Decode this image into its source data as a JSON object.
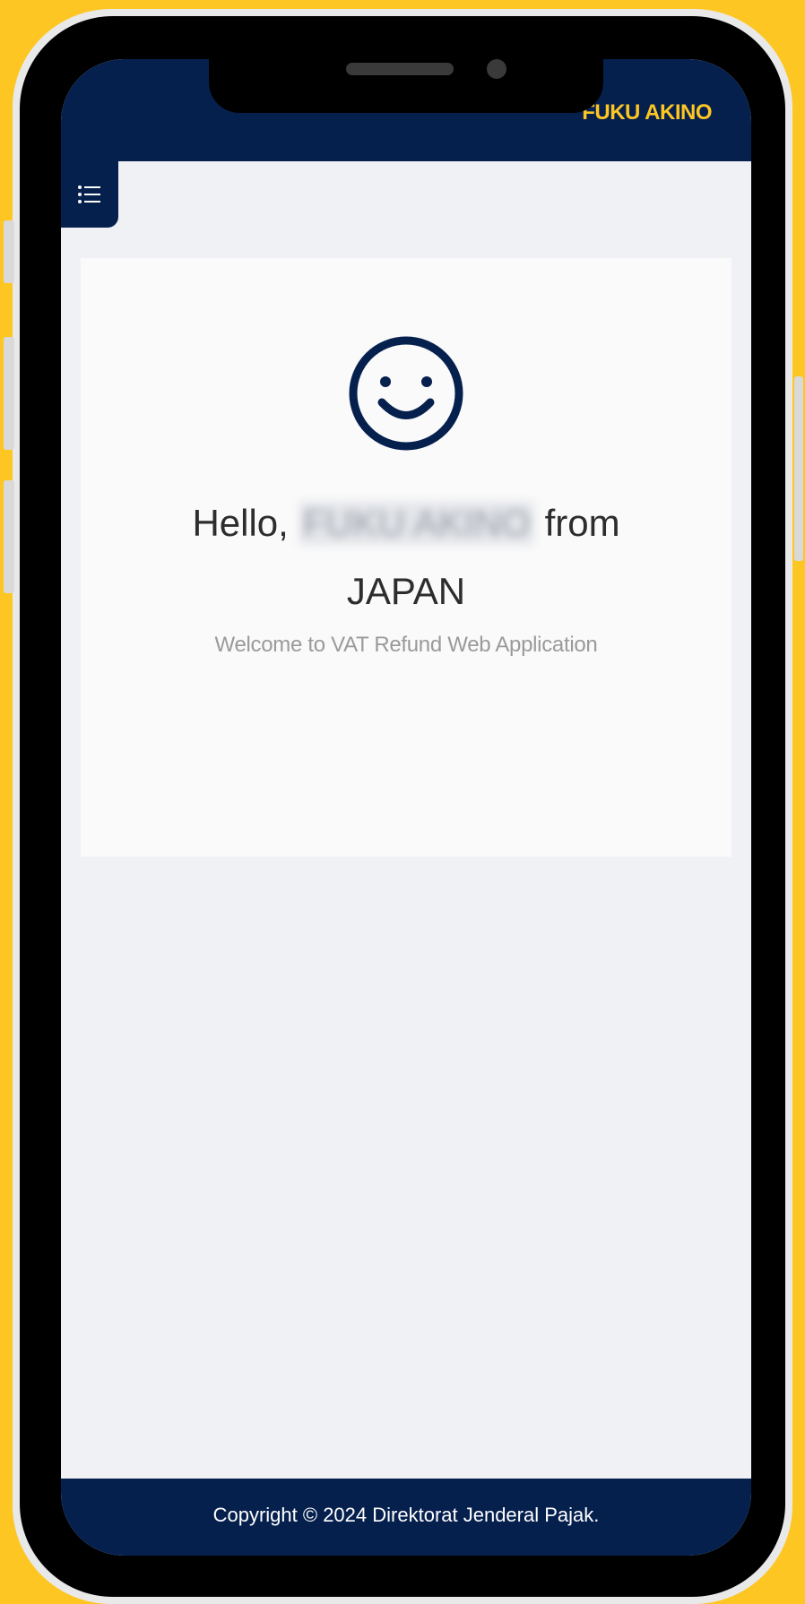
{
  "header": {
    "user_name": "FUKU AKINO"
  },
  "menu": {
    "icon": "list-icon"
  },
  "greeting": {
    "icon": "smiley-icon",
    "hello": "Hello,",
    "name": "FUKU AKINO",
    "from": "from",
    "country": "JAPAN",
    "welcome": "Welcome to VAT Refund Web Application"
  },
  "footer": {
    "copyright": "Copyright © 2024 Direktorat Jenderal Pajak."
  },
  "colors": {
    "background": "#FDC623",
    "navy": "#06204E",
    "accent_yellow": "#FDC623",
    "screen_bg": "#F0F1F5",
    "card_bg": "#FAFAFA"
  }
}
